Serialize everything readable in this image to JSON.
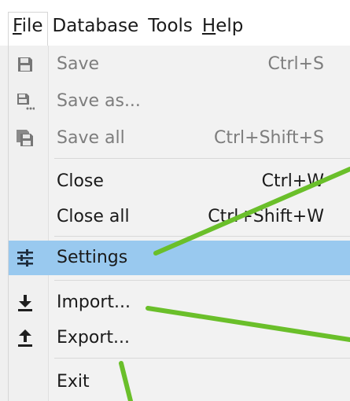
{
  "menubar": {
    "items": [
      {
        "pre": "",
        "mnemonic": "F",
        "post": "ile"
      },
      {
        "pre": "Database",
        "mnemonic": "",
        "post": ""
      },
      {
        "pre": "Tools",
        "mnemonic": "",
        "post": ""
      },
      {
        "pre": "",
        "mnemonic": "H",
        "post": "elp"
      }
    ]
  },
  "file_menu": {
    "save": {
      "label": "Save",
      "shortcut": "Ctrl+S"
    },
    "save_as": {
      "label": "Save as..."
    },
    "save_all": {
      "label": "Save all",
      "shortcut": "Ctrl+Shift+S"
    },
    "close": {
      "label": "Close",
      "shortcut": "Ctrl+W"
    },
    "close_all": {
      "label": "Close all",
      "shortcut": "Ctrl+Shift+W"
    },
    "settings": {
      "label": "Settings"
    },
    "import": {
      "label": "Import..."
    },
    "export": {
      "label": "Export..."
    },
    "exit": {
      "label": "Exit"
    }
  },
  "colors": {
    "highlight": "#99c9ef",
    "annotation_line": "#6abf2a",
    "disabled_text": "#7d7d7d"
  }
}
